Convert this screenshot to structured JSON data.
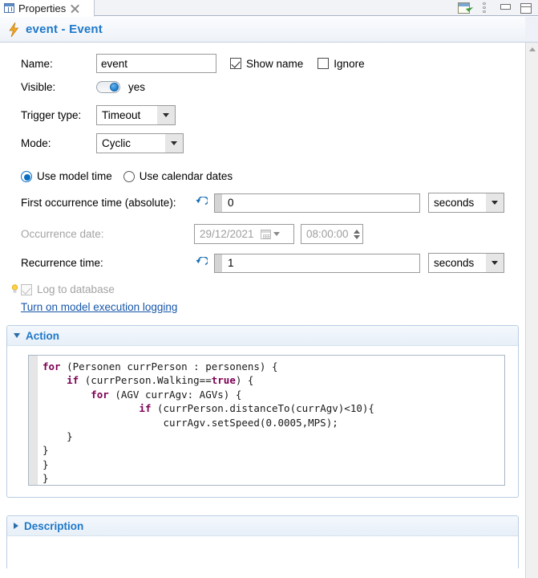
{
  "window": {
    "tab_label": "Properties",
    "tab_icon": "properties-grid-icon",
    "toolbar": {
      "detach_title": "Detach view",
      "menu_title": "View menu",
      "minimize_title": "Minimize",
      "maximize_title": "Maximize"
    }
  },
  "header": {
    "icon": "lightning-bolt-icon",
    "title": "event - Event",
    "accent_color": "#1e78c8"
  },
  "form": {
    "name_label": "Name:",
    "name_value": "event",
    "show_name_label": "Show name",
    "show_name_checked": true,
    "ignore_label": "Ignore",
    "ignore_checked": false,
    "visible_label": "Visible:",
    "visible_value": "yes",
    "visible_on": true,
    "trigger_type_label": "Trigger type:",
    "trigger_type_value": "Timeout",
    "mode_label": "Mode:",
    "mode_value": "Cyclic",
    "use_model_time_label": "Use model time",
    "use_model_time_selected": true,
    "use_calendar_dates_label": "Use calendar dates",
    "use_calendar_dates_selected": false,
    "first_occurrence_label": "First occurrence time (absolute):",
    "first_occurrence_value": "0",
    "first_occurrence_unit": "seconds",
    "occurrence_date_label": "Occurrence date:",
    "occurrence_date_value": "29/12/2021",
    "occurrence_time_value": "08:00:00",
    "recurrence_label": "Recurrence time:",
    "recurrence_value": "1",
    "recurrence_unit": "seconds",
    "log_to_database_label": "Log to database",
    "log_to_database_checked": true,
    "log_to_database_enabled": false,
    "logging_link": "Turn on model execution logging"
  },
  "action": {
    "title": "Action",
    "expanded": true,
    "code_lines": [
      {
        "indent": 0,
        "parts": [
          {
            "t": "for",
            "k": true
          },
          {
            "t": " (Personen currPerson : personens) {",
            "k": false
          }
        ]
      },
      {
        "indent": 1,
        "parts": [
          {
            "t": "if",
            "k": true
          },
          {
            "t": " (currPerson.Walking==",
            "k": false
          },
          {
            "t": "true",
            "k": true
          },
          {
            "t": ") {",
            "k": false
          }
        ]
      },
      {
        "indent": 2,
        "parts": [
          {
            "t": "for",
            "k": true
          },
          {
            "t": " (AGV currAgv: AGVs) {",
            "k": false
          }
        ]
      },
      {
        "indent": 4,
        "parts": [
          {
            "t": "if",
            "k": true
          },
          {
            "t": " (currPerson.distanceTo(currAgv)<10){",
            "k": false
          }
        ]
      },
      {
        "indent": 5,
        "parts": [
          {
            "t": "currAgv.setSpeed(0.0005,MPS);",
            "k": false
          }
        ]
      },
      {
        "indent": 1,
        "parts": [
          {
            "t": "}",
            "k": false
          }
        ]
      },
      {
        "indent": 0,
        "parts": [
          {
            "t": "}",
            "k": false
          }
        ]
      },
      {
        "indent": 0,
        "parts": [
          {
            "t": "}",
            "k": false
          }
        ]
      },
      {
        "indent": 0,
        "parts": [
          {
            "t": "}",
            "k": false
          }
        ]
      }
    ]
  },
  "description": {
    "title": "Description",
    "expanded": false
  }
}
